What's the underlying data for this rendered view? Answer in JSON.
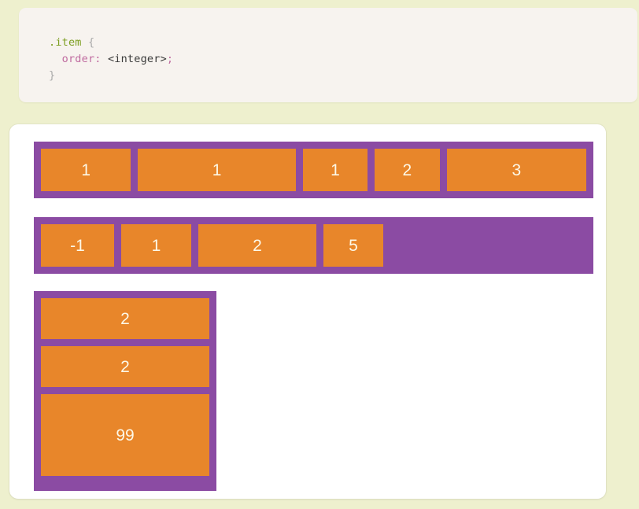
{
  "page": {
    "background_color": "#eef0ce"
  },
  "code_block": {
    "background_color": "#f7f3ef",
    "selector": ".item",
    "open_brace": " {",
    "property": "order",
    "colon": ": ",
    "value": "<integer>",
    "semicolon": ";",
    "close_brace": "}",
    "colors": {
      "selector": "#7c9e20",
      "property": "#c06ba0",
      "value": "#3b3b3b",
      "brace": "#a9a9a9"
    }
  },
  "demo": {
    "container_color": "#8b4ba3",
    "item_color": "#e8862a",
    "item_text_color": "#fdf8e7",
    "rows": [
      {
        "name": "order-demo-row-1",
        "direction": "row",
        "items": [
          {
            "label": "1"
          },
          {
            "label": "1"
          },
          {
            "label": "1"
          },
          {
            "label": "2"
          },
          {
            "label": "3"
          }
        ]
      },
      {
        "name": "order-demo-row-2",
        "direction": "row",
        "items": [
          {
            "label": "-1"
          },
          {
            "label": "1"
          },
          {
            "label": "2"
          },
          {
            "label": "5"
          }
        ]
      },
      {
        "name": "order-demo-column",
        "direction": "column",
        "items": [
          {
            "label": "2"
          },
          {
            "label": "2"
          },
          {
            "label": "99"
          }
        ]
      }
    ]
  }
}
